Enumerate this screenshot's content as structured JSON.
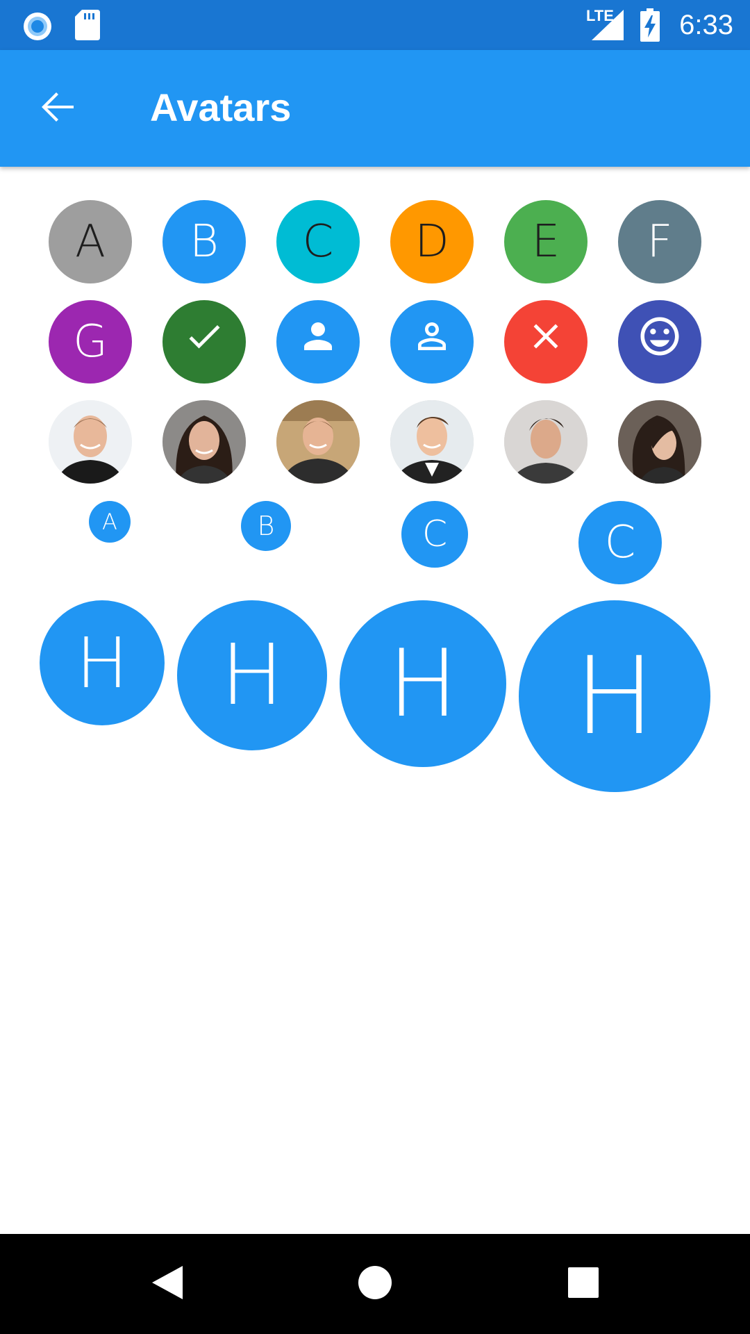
{
  "status_bar": {
    "time": "6:33",
    "network": "LTE",
    "icons": [
      "sync-icon",
      "sd-card-icon",
      "signal-icon",
      "battery-charging-icon"
    ]
  },
  "app_bar": {
    "title": "Avatars",
    "back_icon": "arrow-back-icon"
  },
  "letter_avatars": [
    {
      "letter": "A",
      "color": "#9E9E9E"
    },
    {
      "letter": "B",
      "color": "#2196F3"
    },
    {
      "letter": "C",
      "color": "#00BCD4"
    },
    {
      "letter": "D",
      "color": "#FF9800"
    },
    {
      "letter": "E",
      "color": "#4CAF50"
    },
    {
      "letter": "F",
      "color": "#607D8B"
    },
    {
      "letter": "G",
      "color": "#9C27B0"
    }
  ],
  "icon_avatars": [
    {
      "icon": "check-icon",
      "color": "#2E7D32"
    },
    {
      "icon": "person-icon",
      "color": "#2196F3"
    },
    {
      "icon": "person-outline-icon",
      "color": "#2196F3"
    },
    {
      "icon": "close-icon",
      "color": "#F44336"
    },
    {
      "icon": "smiley-icon",
      "color": "#3F51B5"
    }
  ],
  "photo_avatars": [
    {
      "name": "photo-avatar-1"
    },
    {
      "name": "photo-avatar-2"
    },
    {
      "name": "photo-avatar-3"
    },
    {
      "name": "photo-avatar-4"
    },
    {
      "name": "photo-avatar-5"
    },
    {
      "name": "photo-avatar-6"
    }
  ],
  "size_row_small": [
    "A",
    "B",
    "C",
    "C"
  ],
  "size_row_large": [
    "H",
    "H",
    "H",
    "H"
  ],
  "colors": {
    "primary": "#2196F3",
    "primary_dark": "#1976D2"
  }
}
